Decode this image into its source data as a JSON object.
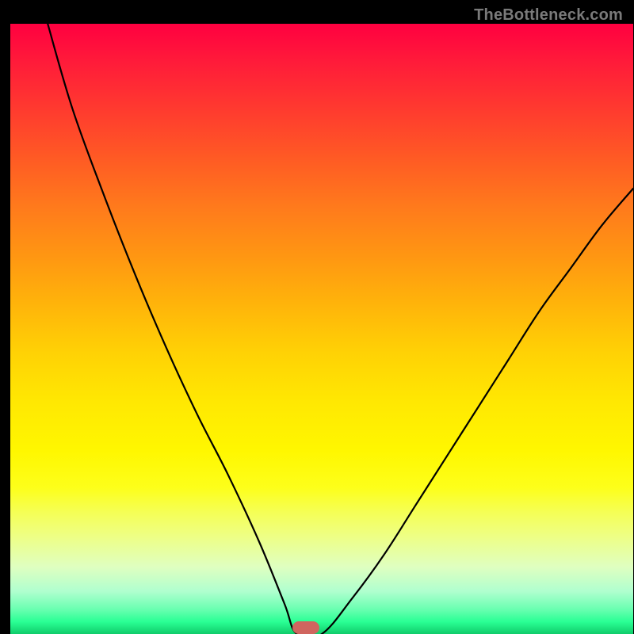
{
  "watermark": {
    "text": "TheBottleneck.com"
  },
  "marker": {
    "x_pct": 47.5,
    "y_pct": 99.0,
    "color": "#d0655f"
  },
  "chart_data": {
    "type": "line",
    "title": "",
    "xlabel": "",
    "ylabel": "",
    "xlim": [
      0,
      100
    ],
    "ylim": [
      0,
      100
    ],
    "grid": false,
    "legend": false,
    "background": "red-yellow-green vertical gradient (bottleneck heatmap)",
    "series": [
      {
        "name": "left-branch",
        "x": [
          6,
          10,
          15,
          20,
          25,
          30,
          35,
          40,
          44,
          46
        ],
        "y": [
          100,
          86,
          72,
          59,
          47,
          36,
          26,
          15,
          5,
          0
        ]
      },
      {
        "name": "flat-minimum",
        "x": [
          46,
          50
        ],
        "y": [
          0,
          0
        ]
      },
      {
        "name": "right-branch",
        "x": [
          50,
          55,
          60,
          65,
          70,
          75,
          80,
          85,
          90,
          95,
          100
        ],
        "y": [
          0,
          6,
          13,
          21,
          29,
          37,
          45,
          53,
          60,
          67,
          73
        ]
      }
    ],
    "marker": {
      "x": 47.5,
      "y": 1,
      "shape": "pill",
      "color": "#d0655f"
    }
  }
}
